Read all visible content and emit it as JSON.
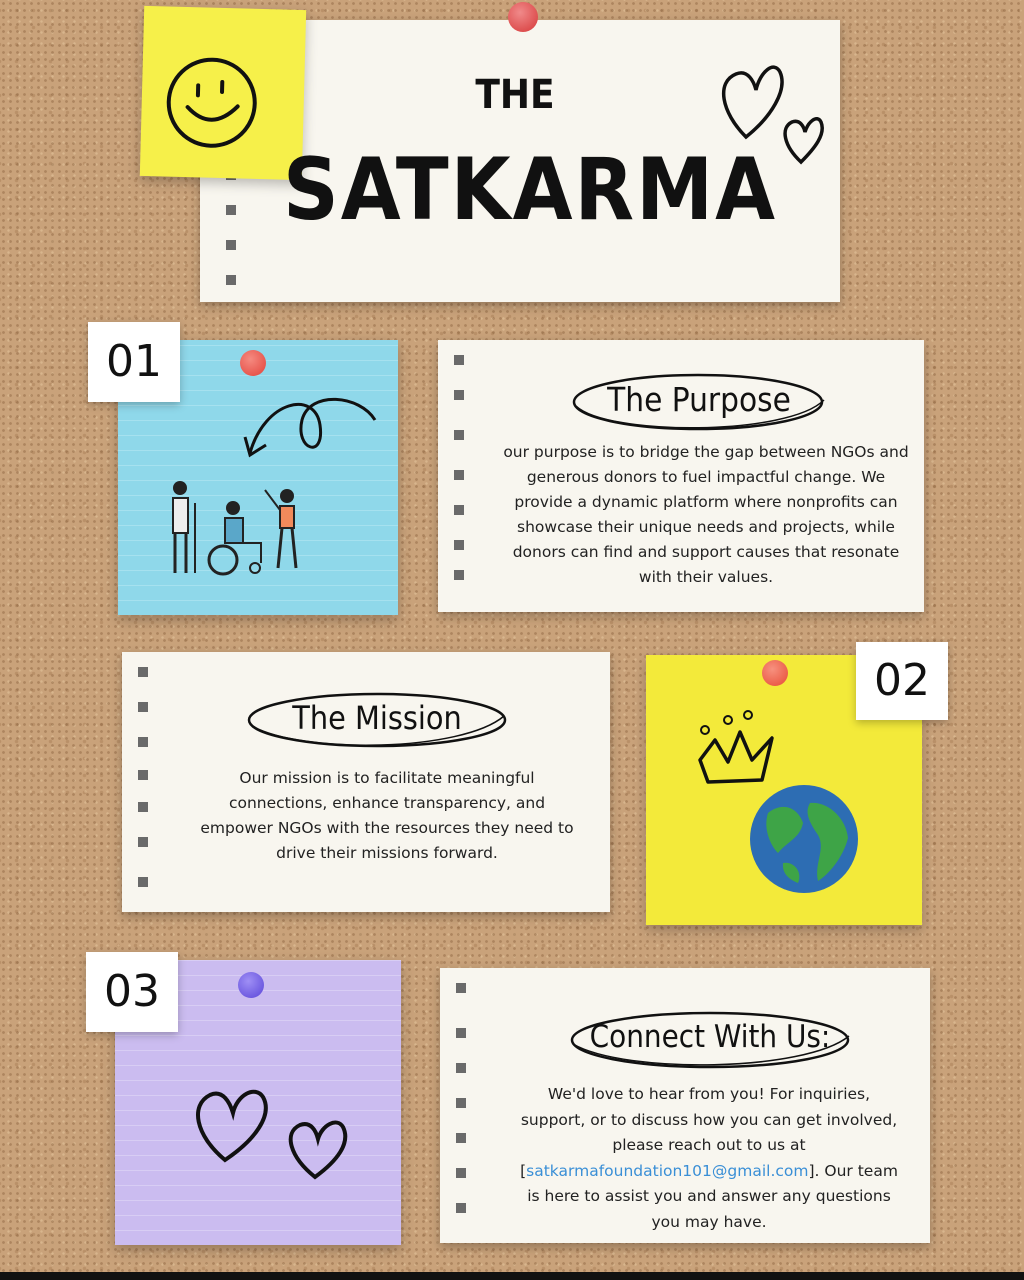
{
  "header": {
    "the": "THE",
    "title": "SATKARMA"
  },
  "sections": [
    {
      "number": "01",
      "heading": "The Purpose",
      "body": "our purpose is to bridge the gap between NGOs and generous donors to fuel impactful change. We provide a dynamic platform where nonprofits can showcase their unique needs and projects, while donors can find and support causes that resonate with their values.",
      "note_color": "#8fd8ea",
      "pin_color": "#e8554f"
    },
    {
      "number": "02",
      "heading": "The Mission",
      "body": "Our mission is to facilitate meaningful connections, enhance transparency, and empower NGOs with the resources they need to drive their missions forward.",
      "note_color": "#f3ea3a",
      "pin_color": "#ee5a45"
    },
    {
      "number": "03",
      "heading": "Connect With Us:",
      "body_before": "We'd love to hear from you! For inquiries, support, or to discuss how you can get involved, please reach out to us at [",
      "email": "satkarmafoundation101@gmail.com",
      "body_after": "]. Our team is here to assist you and answer any questions you may have.",
      "note_color": "#cbbcf0",
      "pin_color": "#6f5be0"
    }
  ],
  "icons": [
    "smiley-icon",
    "hearts-icon",
    "arrow-loop-icon",
    "people-icon",
    "crown-icon",
    "globe-icon",
    "two-hearts-icon"
  ]
}
